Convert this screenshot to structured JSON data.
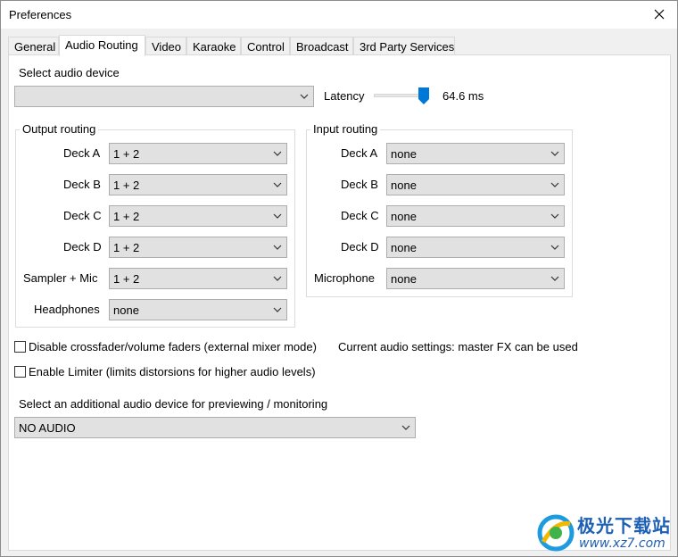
{
  "window": {
    "title": "Preferences"
  },
  "tabs": [
    {
      "label": "General"
    },
    {
      "label": "Audio Routing"
    },
    {
      "label": "Video"
    },
    {
      "label": "Karaoke"
    },
    {
      "label": "Control"
    },
    {
      "label": "Broadcast"
    },
    {
      "label": "3rd Party Services"
    }
  ],
  "audio": {
    "select_device_label": "Select audio device",
    "device_value": "",
    "latency_label": "Latency",
    "latency_value": "64.6 ms",
    "latency_slider_fraction": 0.9
  },
  "output_routing": {
    "title": "Output routing",
    "rows": [
      {
        "label": "Deck A",
        "value": "1 + 2"
      },
      {
        "label": "Deck B",
        "value": "1 + 2"
      },
      {
        "label": "Deck C",
        "value": "1 + 2"
      },
      {
        "label": "Deck D",
        "value": "1 + 2"
      },
      {
        "label": "Sampler + Mic",
        "value": "1 + 2"
      },
      {
        "label": "Headphones",
        "value": "none"
      }
    ]
  },
  "input_routing": {
    "title": "Input routing",
    "rows": [
      {
        "label": "Deck A",
        "value": "none"
      },
      {
        "label": "Deck B",
        "value": "none"
      },
      {
        "label": "Deck C",
        "value": "none"
      },
      {
        "label": "Deck D",
        "value": "none"
      },
      {
        "label": "Microphone",
        "value": "none"
      }
    ]
  },
  "options": {
    "disable_crossfader_label": "Disable crossfader/volume faders (external mixer mode)",
    "disable_crossfader_checked": false,
    "current_settings_text": "Current audio settings: master FX can be used",
    "enable_limiter_label": "Enable Limiter (limits distorsions for higher audio levels)",
    "enable_limiter_checked": false
  },
  "preview": {
    "label": "Select an additional audio device for previewing / monitoring",
    "value": "NO AUDIO"
  },
  "watermark": {
    "line1": "极光下载站",
    "line2": "www.xz7.com"
  },
  "colors": {
    "accent": "#0078d7",
    "watermark": "#1d5fb5"
  }
}
